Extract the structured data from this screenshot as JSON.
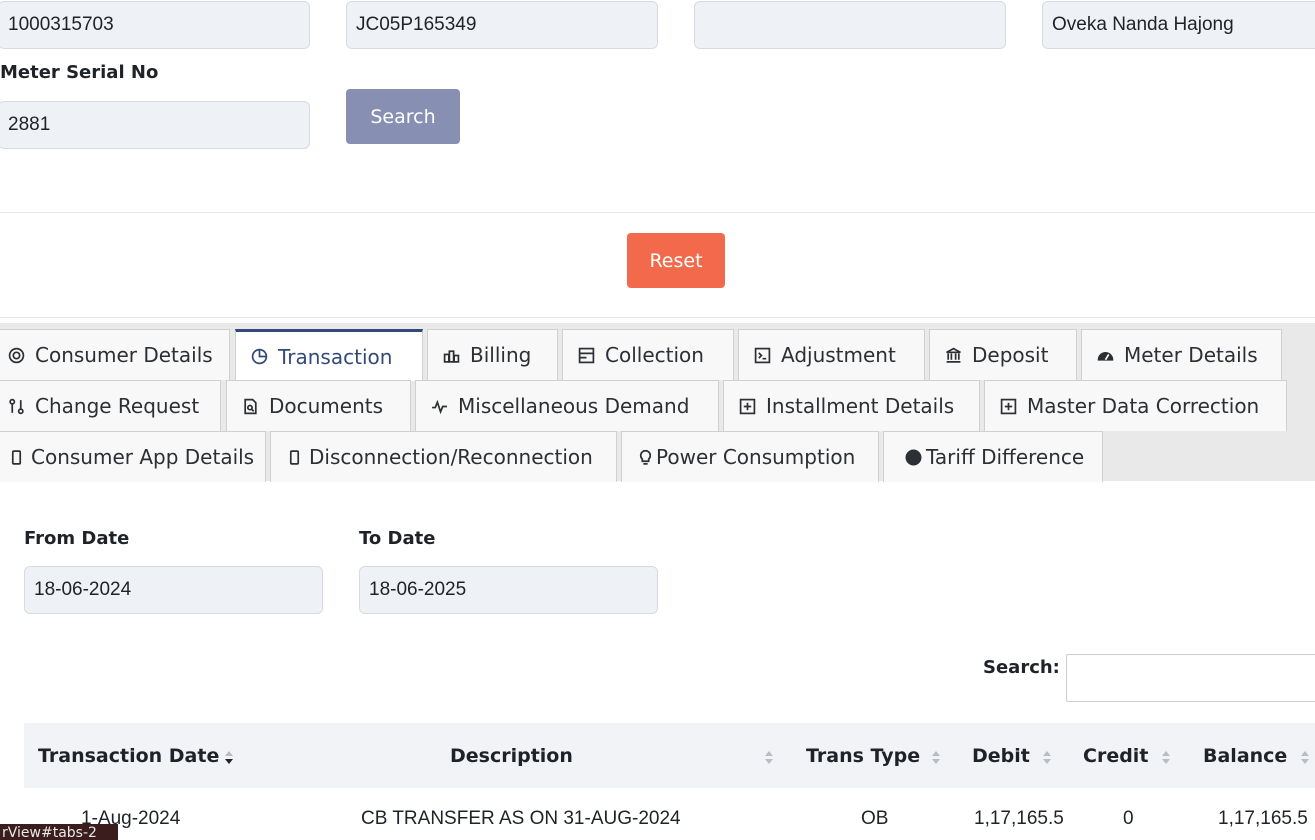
{
  "top_fields": {
    "field1_value": "1000315703",
    "field2_value": "JC05P165349",
    "field3_value": "",
    "field4_value": "Oveka Nanda Hajong",
    "meter_serial_label": "Meter Serial No",
    "meter_serial_value": "2881"
  },
  "buttons": {
    "search": "Search",
    "reset": "Reset"
  },
  "tabs": [
    {
      "label": "Consumer Details",
      "icon": "target-icon"
    },
    {
      "label": "Transaction",
      "icon": "pie-chart-icon",
      "active": true
    },
    {
      "label": "Billing",
      "icon": "bar-chart-icon"
    },
    {
      "label": "Collection",
      "icon": "layout-icon"
    },
    {
      "label": "Adjustment",
      "icon": "terminal-icon"
    },
    {
      "label": "Deposit",
      "icon": "bank-icon"
    },
    {
      "label": "Meter Details",
      "icon": "speedometer-icon"
    },
    {
      "label": "Change Request",
      "icon": "git-compare-icon"
    },
    {
      "label": "Documents",
      "icon": "file-search-icon"
    },
    {
      "label": "Miscellaneous Demand",
      "icon": "activity-icon"
    },
    {
      "label": "Installment Details",
      "icon": "plus-square-icon"
    },
    {
      "label": "Master Data Correction",
      "icon": "plus-square-icon"
    },
    {
      "label": "Consumer App Details",
      "icon": "phone-icon"
    },
    {
      "label": "Disconnection/Reconnection",
      "icon": "phone-icon"
    },
    {
      "label": "Power Consumption",
      "icon": "bulb-icon"
    },
    {
      "label": "Tariff Difference",
      "icon": "circle-icon"
    }
  ],
  "filters": {
    "from_label": "From Date",
    "from_value": "18-06-2024",
    "to_label": "To Date",
    "to_value": "18-06-2025"
  },
  "table": {
    "search_label": "Search:",
    "headers": [
      "Transaction Date",
      "Description",
      "Trans Type",
      "Debit",
      "Credit",
      "Balance"
    ],
    "rows": [
      [
        "1-Aug-2024",
        "CB TRANSFER AS ON 31-AUG-2024",
        "OB",
        "1,17,165.5",
        "0",
        "1,17,165.5"
      ]
    ]
  },
  "status_url": "rView#tabs-2",
  "colors": {
    "search_button": "#8790b3",
    "reset_button": "#f26a4b",
    "active_tab": "#33497a"
  }
}
